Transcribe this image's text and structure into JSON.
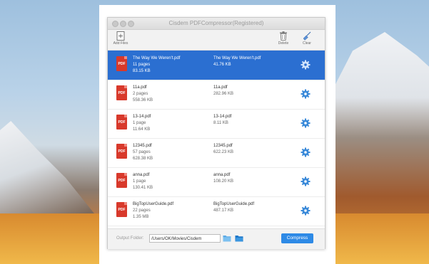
{
  "app": {
    "title": "Cisdem PDFCompressor(Registered)"
  },
  "toolbar": {
    "add_label": "Add Files",
    "delete_label": "Delete",
    "clear_label": "Clear"
  },
  "files": [
    {
      "name": "The Way We Weren't.pdf",
      "pages": "11 pages",
      "size": "83.15 KB",
      "out_name": "The Way We Weren't.pdf",
      "out_size": "41.76 KB",
      "selected": true
    },
    {
      "name": "11a.pdf",
      "pages": "2 pages",
      "size": "558.36 KB",
      "out_name": "11a.pdf",
      "out_size": "282.96 KB"
    },
    {
      "name": "13-14.pdf",
      "pages": "1 page",
      "size": "11.64 KB",
      "out_name": "13-14.pdf",
      "out_size": "8.11 KB"
    },
    {
      "name": "12345.pdf",
      "pages": "57 pages",
      "size": "628.38 KB",
      "out_name": "12345.pdf",
      "out_size": "622.23 KB"
    },
    {
      "name": "anna.pdf",
      "pages": "1 page",
      "size": "130.41 KB",
      "out_name": "anna.pdf",
      "out_size": "108.20 KB"
    },
    {
      "name": "BigTopUserGuide.pdf",
      "pages": "22 pages",
      "size": "1.35 MB",
      "out_name": "BigTopUserGuide.pdf",
      "out_size": "487.17 KB"
    }
  ],
  "pdf_icon_text": "PDF",
  "output": {
    "label": "Output Folder:",
    "path": "/Users/OK/Movies/Cisdem"
  },
  "compress_label": "Compress",
  "colors": {
    "selection": "#2b6fd1",
    "accent": "#2e8ae6",
    "pdf_red": "#d8392b",
    "gear": "#3b8ad9"
  }
}
